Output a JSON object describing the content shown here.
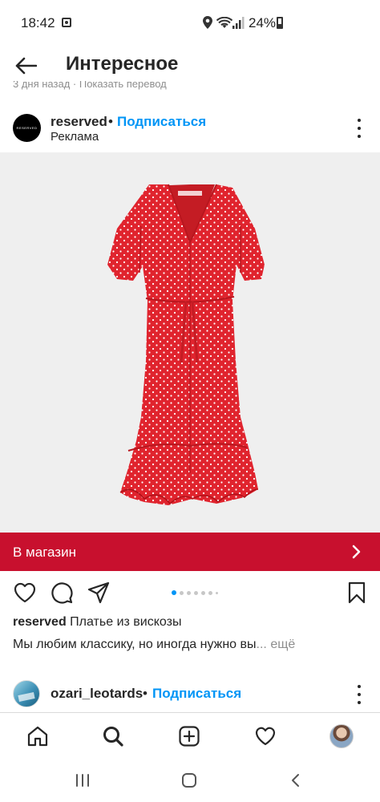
{
  "status_bar": {
    "time": "18:42",
    "battery": "24%",
    "icons": [
      "gallery-icon",
      "location-icon",
      "wifi-icon",
      "signal-icon",
      "battery-icon"
    ]
  },
  "top_bar": {
    "title": "Интересное",
    "back_icon": "arrow-left-icon"
  },
  "clipped_prev": {
    "text": "3 дня назад · Показать перевод"
  },
  "post": {
    "avatar_text": "RESERVED",
    "username": "reserved",
    "separator": "•",
    "follow_label": "Подписаться",
    "sponsored_label": "Реклама",
    "image_alt": "red-polka-dot-dress",
    "shop_label": "В магазин",
    "shop_color": "#c8102e",
    "actions": [
      "heart-icon",
      "comment-icon",
      "share-icon",
      "bookmark-icon"
    ],
    "carousel": {
      "count": 7,
      "active_index": 0
    },
    "caption_user": "reserved",
    "caption_title": "Платье из вискозы",
    "caption_body": "Мы любим классику, но иногда нужно вы",
    "caption_more": "... ещё"
  },
  "next_post": {
    "username": "ozari_leotards",
    "separator": "•",
    "follow_label": "Подписаться"
  },
  "bottom_nav": {
    "items": [
      "home-icon",
      "search-icon",
      "new-post-icon",
      "activity-icon",
      "profile-avatar"
    ]
  },
  "system_nav": {
    "items": [
      "recents-icon",
      "home-circle-icon",
      "back-chevron-icon"
    ]
  },
  "colors": {
    "accent": "#0095f6",
    "text": "#262626",
    "dress": "#e0242e"
  }
}
